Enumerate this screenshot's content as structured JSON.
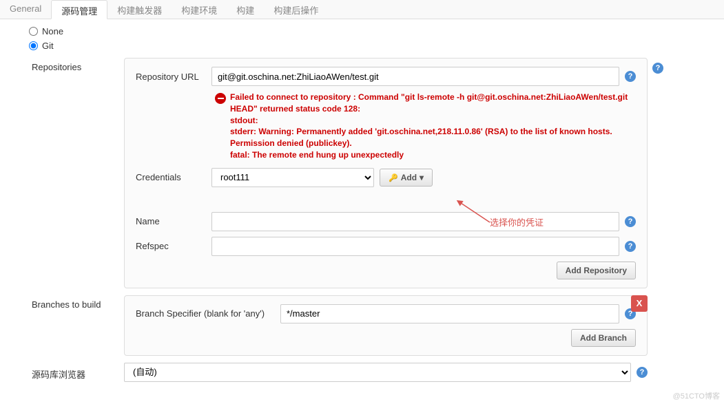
{
  "tabs": {
    "general": "General",
    "scm": "源码管理",
    "triggers": "构建触发器",
    "env": "构建环境",
    "build": "构建",
    "post": "构建后操作"
  },
  "radios": {
    "none": "None",
    "git": "Git"
  },
  "repositories": {
    "label": "Repositories",
    "url_label": "Repository URL",
    "url_value": "git@git.oschina.net:ZhiLiaoAWen/test.git",
    "error": "Failed to connect to repository : Command \"git ls-remote -h git@git.oschina.net:ZhiLiaoAWen/test.git HEAD\" returned status code 128:\nstdout:\nstderr: Warning: Permanently added 'git.oschina.net,218.11.0.86' (RSA) to the list of known hosts.\nPermission denied (publickey).\nfatal: The remote end hung up unexpectedly",
    "cred_label": "Credentials",
    "cred_value": "root111",
    "add_label": "Add",
    "name_label": "Name",
    "name_value": "",
    "refspec_label": "Refspec",
    "refspec_value": "",
    "add_repo": "Add Repository"
  },
  "branches": {
    "label": "Branches to build",
    "specifier_label": "Branch Specifier (blank for 'any')",
    "specifier_value": "*/master",
    "add_branch": "Add Branch",
    "close": "X"
  },
  "browser": {
    "label": "源码库浏览器",
    "value": "(自动)"
  },
  "annotation": "选择你的凭证",
  "watermark": "@51CTO博客"
}
